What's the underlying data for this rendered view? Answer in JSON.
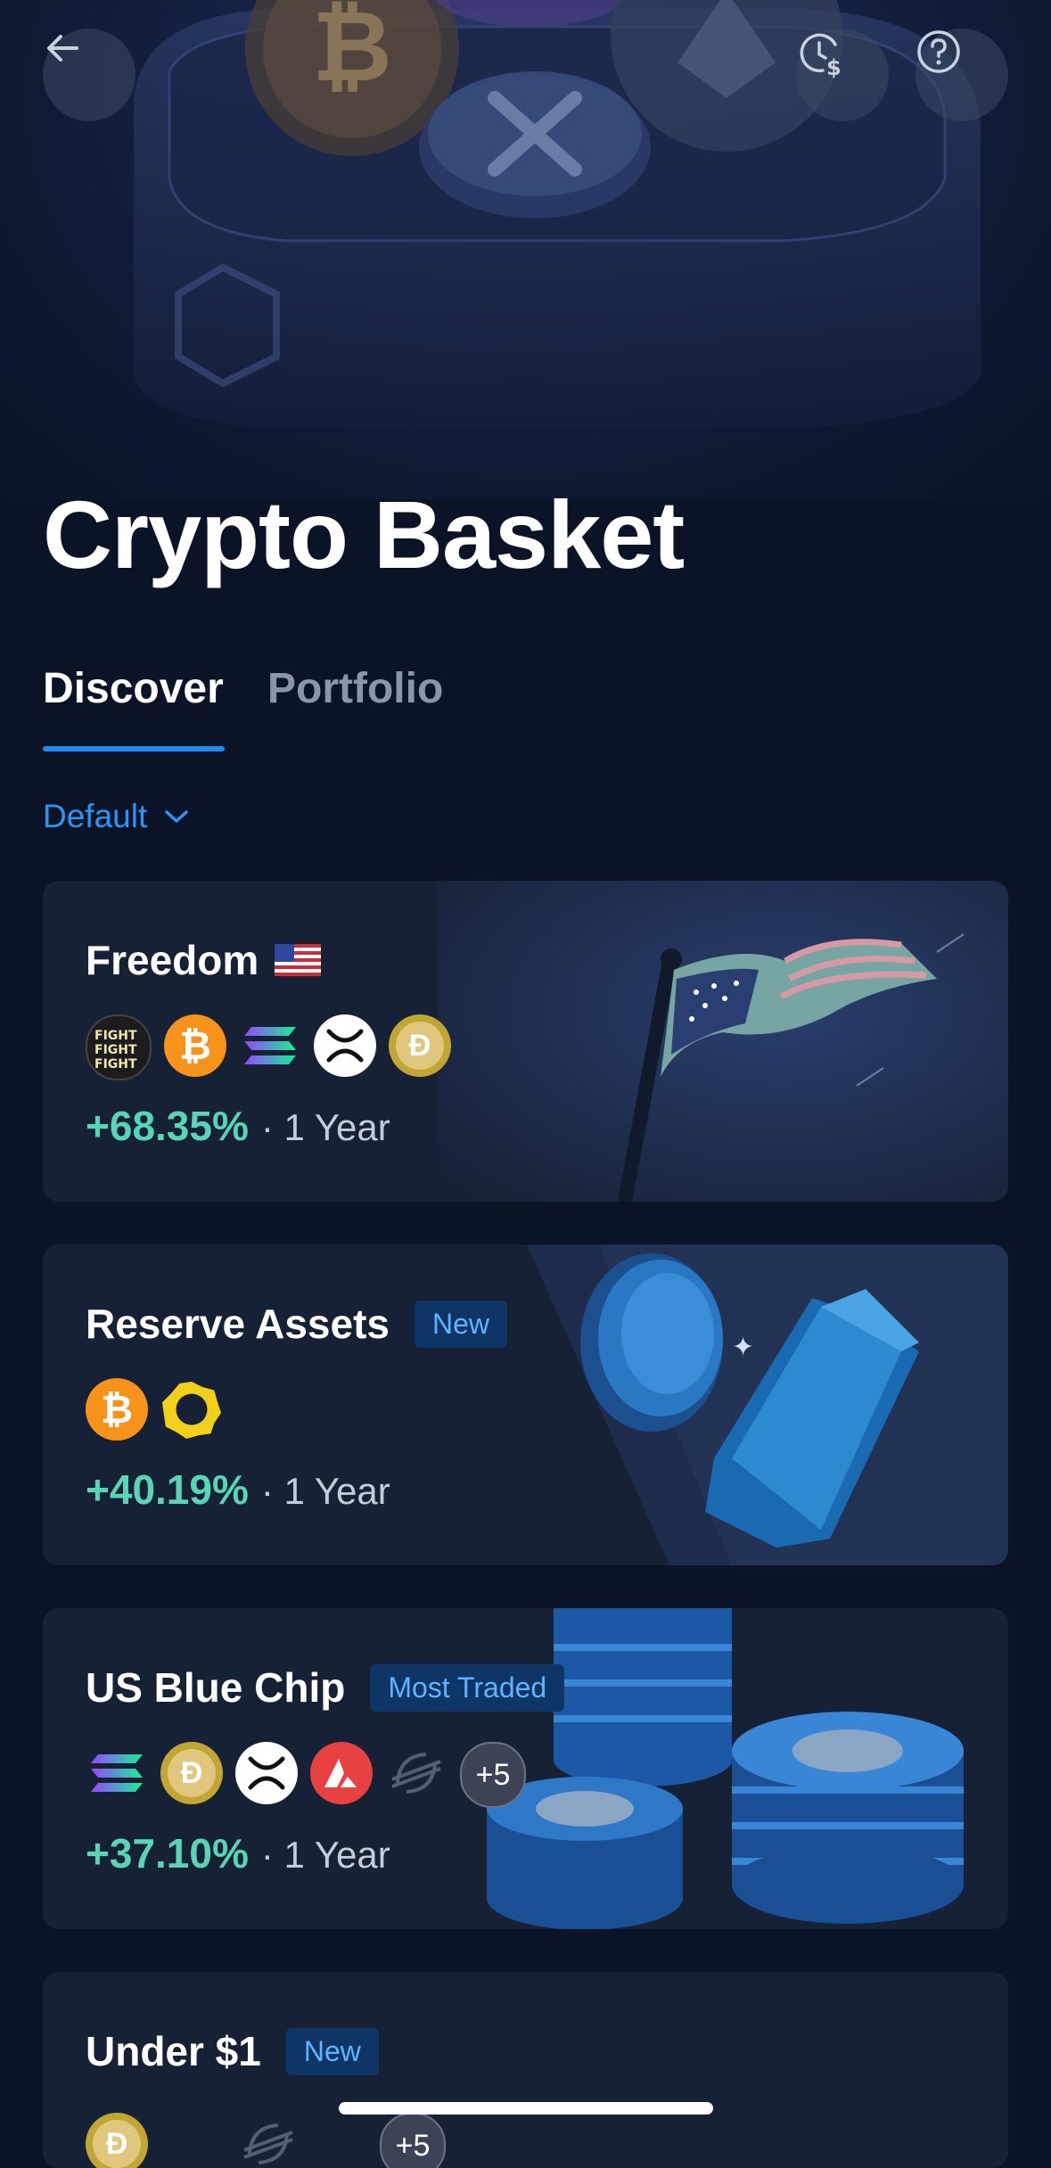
{
  "header": {
    "title": "Crypto Basket",
    "back_icon": "arrow-left-icon",
    "history_icon": "clock-dollar-icon",
    "help_icon": "question-icon"
  },
  "tabs": [
    {
      "label": "Discover",
      "active": true
    },
    {
      "label": "Portfolio",
      "active": false
    }
  ],
  "sort": {
    "label": "Default",
    "icon": "chevron-down-icon"
  },
  "colors": {
    "accent": "#1f8cf5",
    "positive": "#58d4b6",
    "badge_bg": "#0f3466",
    "badge_text": "#5fb4ff"
  },
  "baskets": [
    {
      "name": "Freedom",
      "flag": "🇺🇸",
      "badge": "",
      "coins": [
        "fight-icon",
        "bitcoin-icon",
        "solana-icon",
        "xrp-icon",
        "dogecoin-icon"
      ],
      "extra": "",
      "performance": "+68.35%",
      "period": "· 1 Year"
    },
    {
      "name": "Reserve Assets",
      "flag": "",
      "badge": "New",
      "coins": [
        "bitcoin-icon",
        "paxg-icon"
      ],
      "extra": "",
      "performance": "+40.19%",
      "period": "· 1 Year"
    },
    {
      "name": "US Blue Chip",
      "flag": "",
      "badge": "Most Traded",
      "coins": [
        "solana-icon",
        "dogecoin-icon",
        "xrp-icon",
        "avalanche-icon",
        "stellar-icon"
      ],
      "extra": "+5",
      "performance": "+37.10%",
      "period": "· 1 Year"
    },
    {
      "name": "Under $1",
      "flag": "",
      "badge": "New",
      "coins": [
        "dogecoin-icon",
        "stellar-icon"
      ],
      "extra": "+5",
      "performance": "",
      "period": ""
    }
  ]
}
